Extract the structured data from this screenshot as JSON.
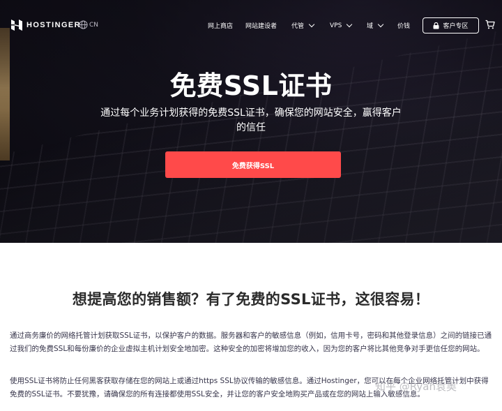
{
  "nav": {
    "logo_text": "HOSTINGER",
    "lang": "CN",
    "menu": [
      {
        "label": "网上商店",
        "dropdown": false,
        "left": 0
      },
      {
        "label": "网站建设者",
        "dropdown": false,
        "left": 0
      },
      {
        "label": "代管",
        "dropdown": true,
        "left": 0
      },
      {
        "label": "VPS",
        "dropdown": true,
        "left": 0
      },
      {
        "label": "域",
        "dropdown": true,
        "left": 0
      },
      {
        "label": "价钱",
        "dropdown": false,
        "left": 0
      }
    ],
    "account_label": "客户专区"
  },
  "hero": {
    "title": "免费SSL证书",
    "subtitle": "通过每个业务计划获得的免费SSL证书，确保您的网站安全，赢得客户的信任",
    "cta_label": "免费获得SSL"
  },
  "section": {
    "title": "想提高您的销售额？有了免费的SSL证书，这很容易！",
    "paragraphs": [
      "通过商务廉价的网络托管计划获取SSL证书，以保护客户的数据。服务器和客户的敏感信息（例如，信用卡号，密码和其他登录信息）之间的链接已通过我们的免费SSL和每份廉价的企业虚拟主机计划安全地加密。这种安全的加密将增加您的收入，因为您的客户将比其他竞争对手更信任您的网站。",
      "使用SSL证书将防止任何黑客获取存储在您的网站上或通过https SSL协议传输的敏感信息。通过Hostinger，您可以在每个企业网络托管计划中获得免费的SSL证书。不要犹豫，请确保您的所有连接都使用SSL安全，并让您的客户安全地购买产品或在您的网站上输入敏感信息。"
    ]
  },
  "watermark": "知乎 @Ryan袁奥",
  "colors": {
    "cta": "#ff4a4a",
    "hero_bg": "#14121c",
    "text_dark": "#2b2b2b"
  }
}
